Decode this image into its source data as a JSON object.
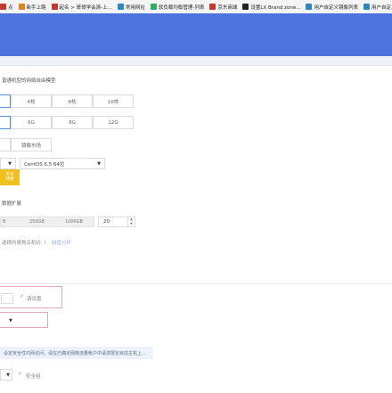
{
  "bookmarks": [
    {
      "icon": "page-icon",
      "label": "点",
      "color": "#c0392b"
    },
    {
      "icon": "page-icon",
      "label": "新手上路",
      "color": "#e67e22"
    },
    {
      "icon": "page-icon",
      "label": "起名 > 哥哥学会清-上...",
      "color": "#c0392b"
    },
    {
      "icon": "page-icon",
      "label": "常用网址",
      "color": "#2e86c1"
    },
    {
      "icon": "page-icon",
      "label": "软负载均衡管理-列表",
      "color": "#27ae60"
    },
    {
      "icon": "page-icon",
      "label": "京东商城",
      "color": "#c0392b"
    },
    {
      "icon": "page-icon",
      "label": "设置LX Brand zone...",
      "color": "#222222"
    },
    {
      "icon": "page-icon",
      "label": "用户自定义镜像列表",
      "color": "#2e86c1"
    },
    {
      "icon": "page-icon",
      "label": "用户自定义镜像",
      "color": "#2e86c1"
    }
  ],
  "form": {
    "intro_text": "普通机型的网络自由模型",
    "cpu_options": [
      "",
      "4核",
      "8核",
      "16核"
    ],
    "memory_options": [
      "",
      "6G",
      "8G",
      "12G"
    ],
    "image_tabs": [
      "",
      "镜像市场"
    ],
    "os_select": {
      "prefix": "",
      "value": "CentOS 6.5 64位"
    },
    "badge_text": [
      "专享",
      "特惠"
    ],
    "disk_label": "数据扩展",
    "disk_slider": {
      "left": "B",
      "mid": "250GB",
      "right": "1000GB"
    },
    "disk_value": "20",
    "disk_hint": "选择的是购买机价（",
    "disk_link": "磁盘分析",
    "password_hint": "请设置",
    "security_notice": "设定安全性内网访问，请在已确定网络流量帐户中请求限定目前主机上...",
    "final_hint": "安全组"
  }
}
